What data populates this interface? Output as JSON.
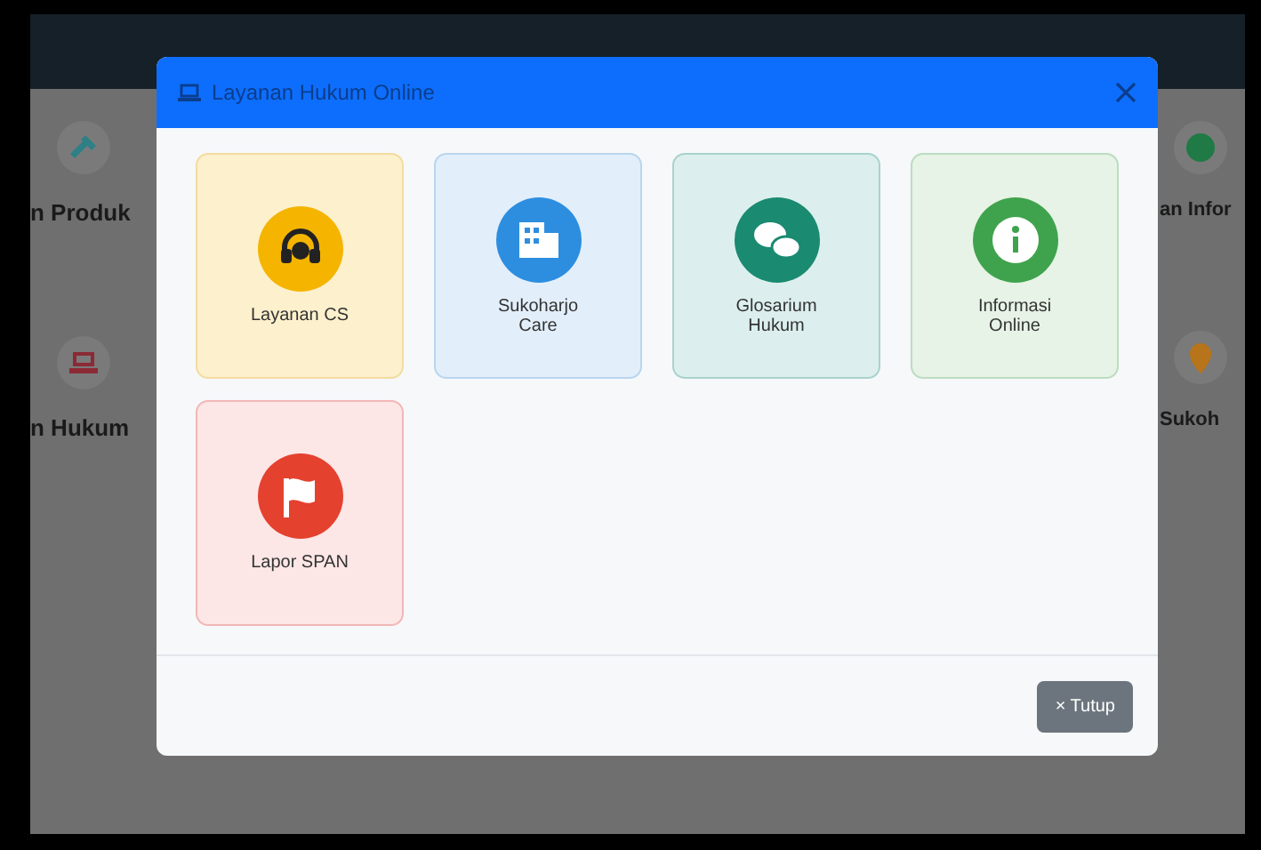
{
  "background": {
    "left_cards": [
      {
        "title": "n Produk",
        "kind": "hammer",
        "color": "#2f7f86"
      },
      {
        "title": "n Hukum",
        "kind": "laptop",
        "color": "#8b2a35"
      }
    ],
    "right_cards": [
      {
        "title": "an Infor",
        "kind": "info",
        "color": "#1f7a45"
      },
      {
        "title": "Sukoh",
        "kind": "pin",
        "color": "#b8741a"
      }
    ]
  },
  "modal": {
    "title": "Layanan Hukum Online",
    "items": [
      {
        "label": "Layanan CS",
        "kind": "headset",
        "color": "#f5b400"
      },
      {
        "label": "Sukoharjo Care",
        "kind": "building",
        "color": "#2d8ee0"
      },
      {
        "label": "Glosarium Hukum",
        "kind": "chat",
        "color": "#1a8a70"
      },
      {
        "label": "Informasi Online",
        "kind": "info",
        "color": "#3fa34d"
      },
      {
        "label": "Lapor SPAN",
        "kind": "flag",
        "color": "#e5412f"
      }
    ],
    "close_button": "× Tutup"
  }
}
